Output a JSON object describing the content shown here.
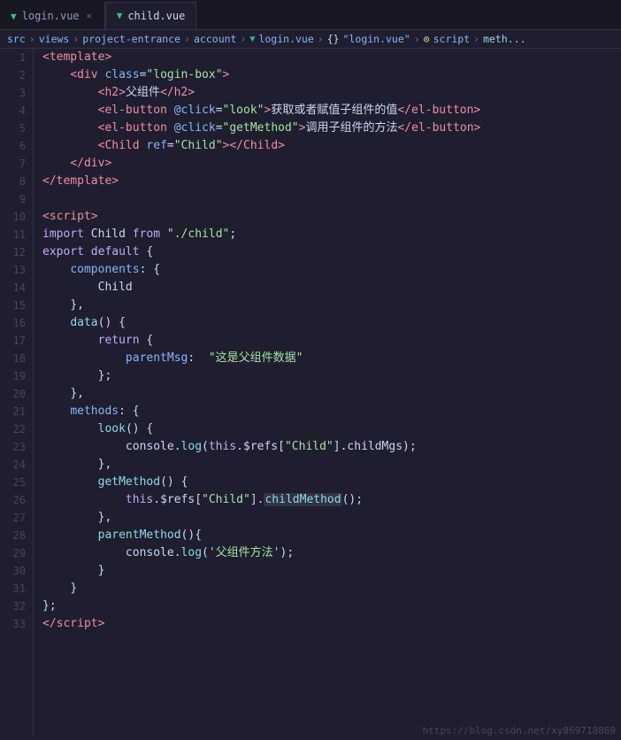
{
  "tabs": [
    {
      "label": "login.vue",
      "active": false,
      "closable": true
    },
    {
      "label": "child.vue",
      "active": true,
      "closable": false
    }
  ],
  "breadcrumb": {
    "parts": [
      "src",
      "views",
      "project-entrance",
      "account",
      "login.vue",
      "{} \"login.vue\"",
      "script",
      "meth..."
    ]
  },
  "lines": [
    {
      "num": 1,
      "html": "<span class='t-tag'>&lt;template&gt;</span>"
    },
    {
      "num": 2,
      "html": "    <span class='t-tag'>&lt;div</span> <span class='t-attr'>class</span><span class='t-punct'>=</span><span class='t-string'>\"login-box\"</span><span class='t-tag'>&gt;</span>"
    },
    {
      "num": 3,
      "html": "        <span class='t-tag'>&lt;h2&gt;</span><span class='t-chinese'>父组件</span><span class='t-tag'>&lt;/h2&gt;</span>"
    },
    {
      "num": 4,
      "html": "        <span class='t-tag'>&lt;el-button</span> <span class='t-attr'>@click</span><span class='t-punct'>=</span><span class='t-string'>\"look\"</span><span class='t-tag'>&gt;</span><span class='t-chinese'>获取或者赋值子组件的值</span><span class='t-tag'>&lt;/el-button&gt;</span>"
    },
    {
      "num": 5,
      "html": "        <span class='t-tag'>&lt;el-button</span> <span class='t-attr'>@click</span><span class='t-punct'>=</span><span class='t-string'>\"getMethod\"</span><span class='t-tag'>&gt;</span><span class='t-chinese'>调用子组件的方法</span><span class='t-tag'>&lt;/el-button&gt;</span>"
    },
    {
      "num": 6,
      "html": "        <span class='t-tag'>&lt;Child</span> <span class='t-attr'>ref</span><span class='t-punct'>=</span><span class='t-string'>\"Child\"</span><span class='t-tag'>&gt;&lt;/Child&gt;</span>"
    },
    {
      "num": 7,
      "html": "    <span class='t-tag'>&lt;/div&gt;</span>"
    },
    {
      "num": 8,
      "html": "<span class='t-tag'>&lt;/template&gt;</span>"
    },
    {
      "num": 9,
      "html": ""
    },
    {
      "num": 10,
      "html": "<span class='t-tag'>&lt;script&gt;</span>"
    },
    {
      "num": 11,
      "html": "<span class='t-import'>import</span> <span class='t-plain'>Child</span> <span class='t-import'>from</span> <span class='t-string'>\"./child\"</span><span class='t-punct'>;</span>"
    },
    {
      "num": 12,
      "html": "<span class='t-keyword'>export default</span> <span class='t-bracket'>{</span>"
    },
    {
      "num": 13,
      "html": "    <span class='t-blue'>components</span><span class='t-punct'>:</span> <span class='t-bracket'>{</span>"
    },
    {
      "num": 14,
      "html": "        <span class='t-plain'>Child</span>"
    },
    {
      "num": 15,
      "html": "    <span class='t-bracket'>},</span>"
    },
    {
      "num": 16,
      "html": "    <span class='t-cyan'>data</span><span class='t-bracket'>()</span> <span class='t-bracket'>{</span>"
    },
    {
      "num": 17,
      "html": "        <span class='t-keyword'>return</span> <span class='t-bracket'>{</span>"
    },
    {
      "num": 18,
      "html": "            <span class='t-blue'>parentMsg</span><span class='t-punct'>:</span>  <span class='t-string'>\"这是父组件数据\"</span>"
    },
    {
      "num": 19,
      "html": "        <span class='t-bracket'>};</span>"
    },
    {
      "num": 20,
      "html": "    <span class='t-bracket'>},</span>"
    },
    {
      "num": 21,
      "html": "    <span class='t-blue'>methods</span><span class='t-punct'>:</span> <span class='t-bracket'>{</span>"
    },
    {
      "num": 22,
      "html": "        <span class='t-cyan'>look</span><span class='t-bracket'>()</span> <span class='t-bracket'>{</span>"
    },
    {
      "num": 23,
      "html": "            <span class='t-plain'>console</span><span class='t-punct'>.</span><span class='t-cyan'>log</span><span class='t-bracket'>(</span><span class='t-keyword'>this</span><span class='t-punct'>.</span><span class='t-plain'>$refs</span><span class='t-bracket'>[</span><span class='t-string'>\"Child\"</span><span class='t-bracket'>]</span><span class='t-punct'>.</span><span class='t-plain'>childMgs</span><span class='t-bracket'>)</span><span class='t-punct'>;</span>"
    },
    {
      "num": 24,
      "html": "        <span class='t-bracket'>},</span>"
    },
    {
      "num": 25,
      "html": "        <span class='t-cyan'>getMethod</span><span class='t-bracket'>()</span> <span class='t-bracket'>{</span>"
    },
    {
      "num": 26,
      "html": "            <span class='t-keyword'>this</span><span class='t-punct'>.</span><span class='t-plain'>$refs</span><span class='t-bracket'>[</span><span class='t-string'>\"Child\"</span><span class='t-bracket'>]</span><span class='t-punct'>.</span><span class='highlight-word t-cyan'>childMethod</span><span class='t-bracket'>()</span><span class='t-punct'>;</span>"
    },
    {
      "num": 27,
      "html": "        <span class='t-bracket'>},</span>"
    },
    {
      "num": 28,
      "html": "        <span class='t-cyan'>parentMethod</span><span class='t-bracket'>()</span><span class='t-bracket'>{</span>"
    },
    {
      "num": 29,
      "html": "            <span class='t-plain'>console</span><span class='t-punct'>.</span><span class='t-cyan'>log</span><span class='t-bracket'>(</span><span class='t-string'>'父组件方法'</span><span class='t-bracket'>)</span><span class='t-punct'>;</span>"
    },
    {
      "num": 30,
      "html": "        <span class='t-bracket'>}</span>"
    },
    {
      "num": 31,
      "html": "    <span class='t-bracket'>}</span>"
    },
    {
      "num": 32,
      "html": "<span class='t-bracket'>};</span>"
    },
    {
      "num": 33,
      "html": "<span class='t-tag'>&lt;/script&gt;</span>"
    }
  ],
  "watermark": "https://blog.csdn.net/xy869718869"
}
